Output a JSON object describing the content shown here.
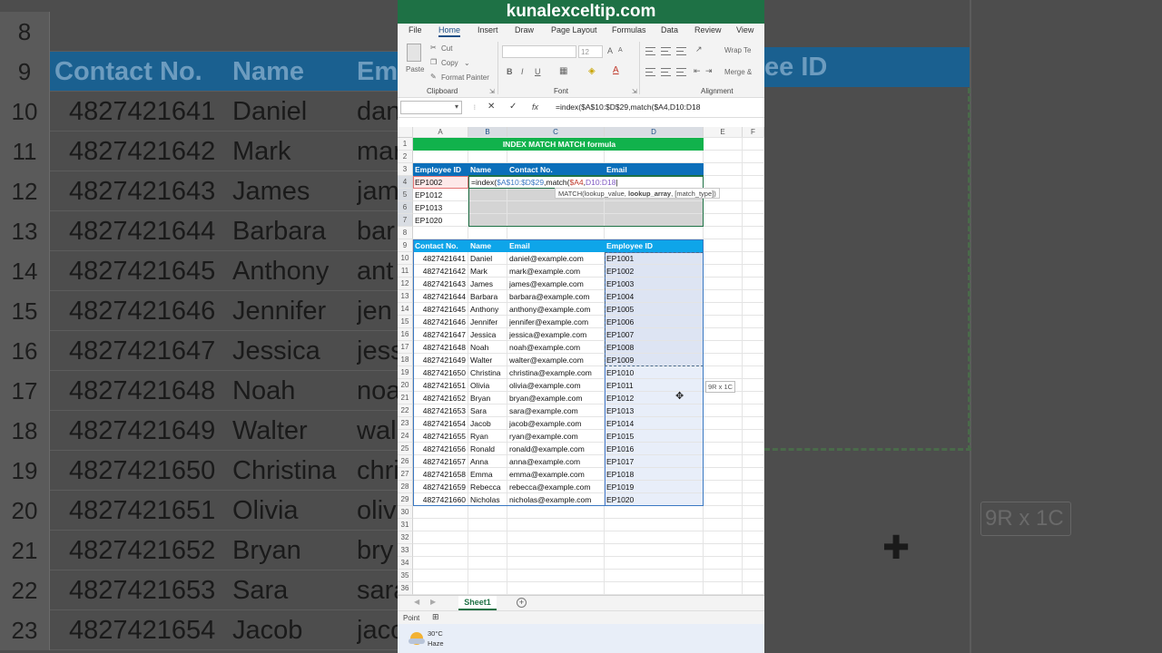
{
  "banner": "kunalexceltip.com",
  "menu": [
    "File",
    "Home",
    "Insert",
    "Draw",
    "Page Layout",
    "Formulas",
    "Data",
    "Review",
    "View"
  ],
  "ribbon": {
    "paste": "Paste",
    "cut": "Cut",
    "copy": "Copy",
    "format_painter": "Format Painter",
    "clipboard": "Clipboard",
    "font_size": "12",
    "font_group": "Font",
    "wrap_text": "Wrap Te",
    "merge": "Merge &",
    "alignment": "Alignment",
    "bold": "B",
    "italic": "I",
    "underline": "U"
  },
  "formula_bar": {
    "fx": "fx",
    "formula": "=index($A$10:$D$29,match($A4,D10:D18"
  },
  "columns": [
    "A",
    "B",
    "C",
    "D",
    "E",
    "F"
  ],
  "title": "INDEX MATCH MATCH formula",
  "lookup_headers": [
    "Employee ID",
    "Name",
    "Contact No.",
    "Email"
  ],
  "lookup_ids": [
    "EP1002",
    "EP1012",
    "EP1013",
    "EP1020"
  ],
  "editing_formula": {
    "p1": "=index(",
    "p2": "$A$10:$D$29",
    "p3": ",match(",
    "p4": "$A4",
    "p5": ",",
    "p6": "D10:D18"
  },
  "tooltip": {
    "t1": "MATCH(lookup_value, ",
    "t2": "lookup_array",
    "t3": ", [match_type])"
  },
  "table_headers": [
    "Contact No.",
    "Name",
    "Email",
    "Employee ID"
  ],
  "table_rows": [
    [
      "4827421641",
      "Daniel",
      "daniel@example.com",
      "EP1001"
    ],
    [
      "4827421642",
      "Mark",
      "mark@example.com",
      "EP1002"
    ],
    [
      "4827421643",
      "James",
      "james@example.com",
      "EP1003"
    ],
    [
      "4827421644",
      "Barbara",
      "barbara@example.com",
      "EP1004"
    ],
    [
      "4827421645",
      "Anthony",
      "anthony@example.com",
      "EP1005"
    ],
    [
      "4827421646",
      "Jennifer",
      "jennifer@example.com",
      "EP1006"
    ],
    [
      "4827421647",
      "Jessica",
      "jessica@example.com",
      "EP1007"
    ],
    [
      "4827421648",
      "Noah",
      "noah@example.com",
      "EP1008"
    ],
    [
      "4827421649",
      "Walter",
      "walter@example.com",
      "EP1009"
    ],
    [
      "4827421650",
      "Christina",
      "christina@example.com",
      "EP1010"
    ],
    [
      "4827421651",
      "Olivia",
      "olivia@example.com",
      "EP1011"
    ],
    [
      "4827421652",
      "Bryan",
      "bryan@example.com",
      "EP1012"
    ],
    [
      "4827421653",
      "Sara",
      "sara@example.com",
      "EP1013"
    ],
    [
      "4827421654",
      "Jacob",
      "jacob@example.com",
      "EP1014"
    ],
    [
      "4827421655",
      "Ryan",
      "ryan@example.com",
      "EP1015"
    ],
    [
      "4827421656",
      "Ronald",
      "ronald@example.com",
      "EP1016"
    ],
    [
      "4827421657",
      "Anna",
      "anna@example.com",
      "EP1017"
    ],
    [
      "4827421658",
      "Emma",
      "emma@example.com",
      "EP1018"
    ],
    [
      "4827421659",
      "Rebecca",
      "rebecca@example.com",
      "EP1019"
    ],
    [
      "4827421660",
      "Nicholas",
      "nicholas@example.com",
      "EP1020"
    ]
  ],
  "size_tip": "9R x 1C",
  "sheet_tab": "Sheet1",
  "status": "Point",
  "weather": {
    "temp": "30°C",
    "cond": "Haze"
  },
  "bg_left_rows": [
    [
      "8",
      "",
      "",
      ""
    ],
    [
      "9",
      "Contact No.",
      "Name",
      "Ema"
    ],
    [
      "10",
      "4827421641",
      "Daniel",
      "dan"
    ],
    [
      "11",
      "4827421642",
      "Mark",
      "mar"
    ],
    [
      "12",
      "4827421643",
      "James",
      "jam"
    ],
    [
      "13",
      "4827421644",
      "Barbara",
      "bar"
    ],
    [
      "14",
      "4827421645",
      "Anthony",
      "ant"
    ],
    [
      "15",
      "4827421646",
      "Jennifer",
      "jen"
    ],
    [
      "16",
      "4827421647",
      "Jessica",
      "jess"
    ],
    [
      "17",
      "4827421648",
      "Noah",
      "noa"
    ],
    [
      "18",
      "4827421649",
      "Walter",
      "wal"
    ],
    [
      "19",
      "4827421650",
      "Christina",
      "chri"
    ],
    [
      "20",
      "4827421651",
      "Olivia",
      "oliv"
    ],
    [
      "21",
      "4827421652",
      "Bryan",
      "bry"
    ],
    [
      "22",
      "4827421653",
      "Sara",
      "sara"
    ],
    [
      "23",
      "4827421654",
      "Jacob",
      "jaco"
    ]
  ],
  "bg_right_header": "ee ID",
  "bg_right_tip": "9R x 1C",
  "colors": {
    "excel_green": "#1e7145",
    "header_blue": "#0b6fba",
    "title_green": "#11b24c",
    "selection": "#e8eef9"
  }
}
